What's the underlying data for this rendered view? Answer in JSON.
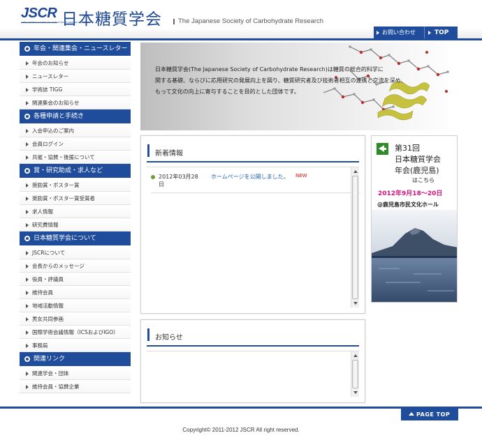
{
  "header": {
    "logo_text": "JSCR",
    "logo_sub": "THE JAPANESE SOCIETY OF CARBOHYDRATE RESEARCH",
    "title_ja": "日本糖質学会",
    "tagline": "The Japanese Society of Carbohydrate Research",
    "contact_label": "お問い合わせ",
    "top_label": "TOP"
  },
  "sidebar": {
    "sections": [
      {
        "heading": "年会・関連集会・ニュースレター",
        "items": [
          "年会のお知らせ",
          "ニュースレター",
          "学術誌 TIGG",
          "関連集会のお知らせ"
        ]
      },
      {
        "heading": "各種申請と手続き",
        "items": [
          "入会申込のご案内",
          "会員ログイン",
          "共催・協賛・後援について"
        ]
      },
      {
        "heading": "賞・研究助成・求人など",
        "items": [
          "奨励賞・ポスター賞",
          "奨励賞・ポスター賞受賞者",
          "求人情報",
          "研究費情報"
        ]
      },
      {
        "heading": "日本糖質学会について",
        "items": [
          "JSCRについて",
          "会長からのメッセージ",
          "役員・評議員",
          "維持会員",
          "地域活動情報",
          "男女共同参画",
          "国際学術会議情報（ICSおよびIGO）",
          "事務局"
        ]
      },
      {
        "heading": "関連リンク",
        "items": [
          "関連学会・団体",
          "維持会員・協賛企業"
        ]
      }
    ]
  },
  "hero": {
    "lines": [
      "日本糖質学会(The Japanese Society of Carbohydrate Research)は糖質の総合的科学に",
      "関する基礎、ならびに応用研究の発展向上を図り、糖質研究者及び技術者相互の連携と交流を深め、",
      "もって文化の向上に寄与することを目的とした団体です。"
    ]
  },
  "news": {
    "title": "新着情報",
    "items": [
      {
        "date": "2012年03月28日",
        "text": "ホームページを公開しました。",
        "badge": "NEW"
      }
    ]
  },
  "notices": {
    "title": "お知らせ"
  },
  "banner": {
    "edition": "第31回",
    "society": "日本糖質学会",
    "meeting": "年会(鹿児島)",
    "here": "はこちら",
    "date": "2012年9月18～20日",
    "venue": "@鹿児島市民文化ホール"
  },
  "footer": {
    "pagetop_label": "PAGE TOP",
    "copyright": "Copyright© 2011-2012 JSCR All right reserved."
  },
  "colors": {
    "brand_blue": "#1f4d9c",
    "link_blue": "#1f5fb5",
    "new_red": "#dd1111",
    "banner_pink": "#d4137a",
    "arrow_green": "#2f8a2a"
  }
}
